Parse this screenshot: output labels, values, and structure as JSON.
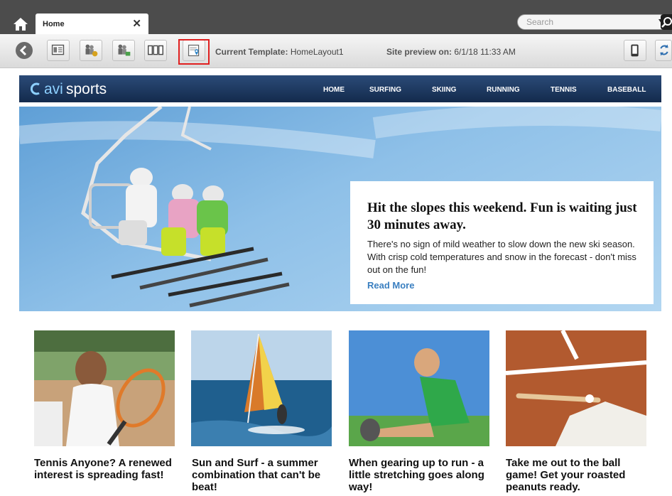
{
  "tabbar": {
    "tab_label": "Home",
    "search_placeholder": "Search"
  },
  "toolbar": {
    "template_label": "Current Template:",
    "template_value": "HomeLayout1",
    "preview_label": "Site preview on:",
    "preview_value": "6/1/18 11:33 AM"
  },
  "site": {
    "logo_prefix": "avi",
    "logo_suffix": "sports",
    "nav": [
      "HOME",
      "SURFING",
      "SKIING",
      "RUNNING",
      "TENNIS",
      "BASEBALL"
    ]
  },
  "hero": {
    "title": "Hit the slopes this weekend. Fun is waiting just 30 minutes away.",
    "body": "There's no sign of mild weather to slow down the new ski season.  With crisp cold temperatures and snow in the forecast - don't miss out on the fun!",
    "link": "Read More"
  },
  "articles": [
    {
      "caption": "Tennis Anyone? A renewed interest is spreading fast!"
    },
    {
      "caption": "Sun and Surf - a summer combination that can't be beat!"
    },
    {
      "caption": "When gearing up to run - a little stretching goes along way!"
    },
    {
      "caption": "Take me out to the ball game! Get your roasted peanuts ready."
    }
  ],
  "colors": {
    "tabbar_bg": "#4c4c4c",
    "nav_bg": "#1c3a63",
    "link": "#3a7fc0",
    "highlight": "#e02020"
  }
}
